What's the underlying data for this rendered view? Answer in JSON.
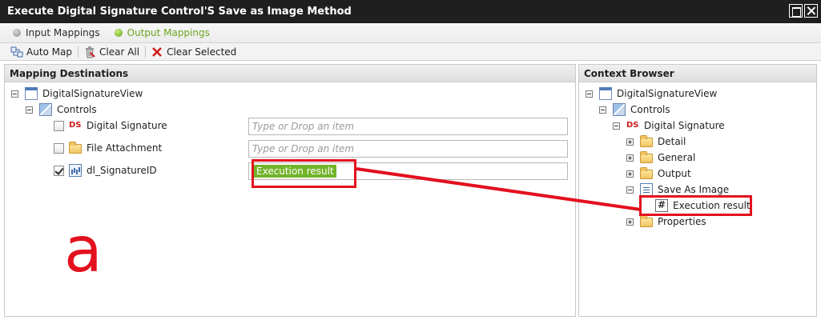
{
  "window": {
    "title": "Execute Digital Signature Control'S Save as Image Method"
  },
  "tabs": [
    {
      "label": "Input Mappings",
      "active": false
    },
    {
      "label": "Output Mappings",
      "active": true
    }
  ],
  "toolbar": {
    "auto_map": "Auto Map",
    "clear_all": "Clear All",
    "clear_selected": "Clear Selected"
  },
  "mapping": {
    "header": "Mapping Destinations",
    "root": "DigitalSignatureView",
    "controls": "Controls",
    "items": [
      {
        "badge": "DS",
        "label": "Digital Signature",
        "checked": false,
        "placeholder": "Type or Drop an item"
      },
      {
        "label": "File Attachment",
        "checked": false,
        "placeholder": "Type or Drop an item"
      },
      {
        "label": "dl_SignatureID",
        "checked": true,
        "value": "Execution result"
      }
    ]
  },
  "context": {
    "header": "Context Browser",
    "root": "DigitalSignatureView",
    "controls": "Controls",
    "control_badge": "DS",
    "control": "Digital Signature",
    "children": [
      "Detail",
      "General",
      "Output",
      "Save As Image",
      "Properties"
    ],
    "method_child": "Execution result"
  },
  "annotation": {
    "letter": "a",
    "color": "#e3101e"
  },
  "colors": {
    "titlebar": "#1f1f1f",
    "active_tab": "#6aa420",
    "result_chip": "#72b42a",
    "annotation_red": "#e3101e"
  }
}
